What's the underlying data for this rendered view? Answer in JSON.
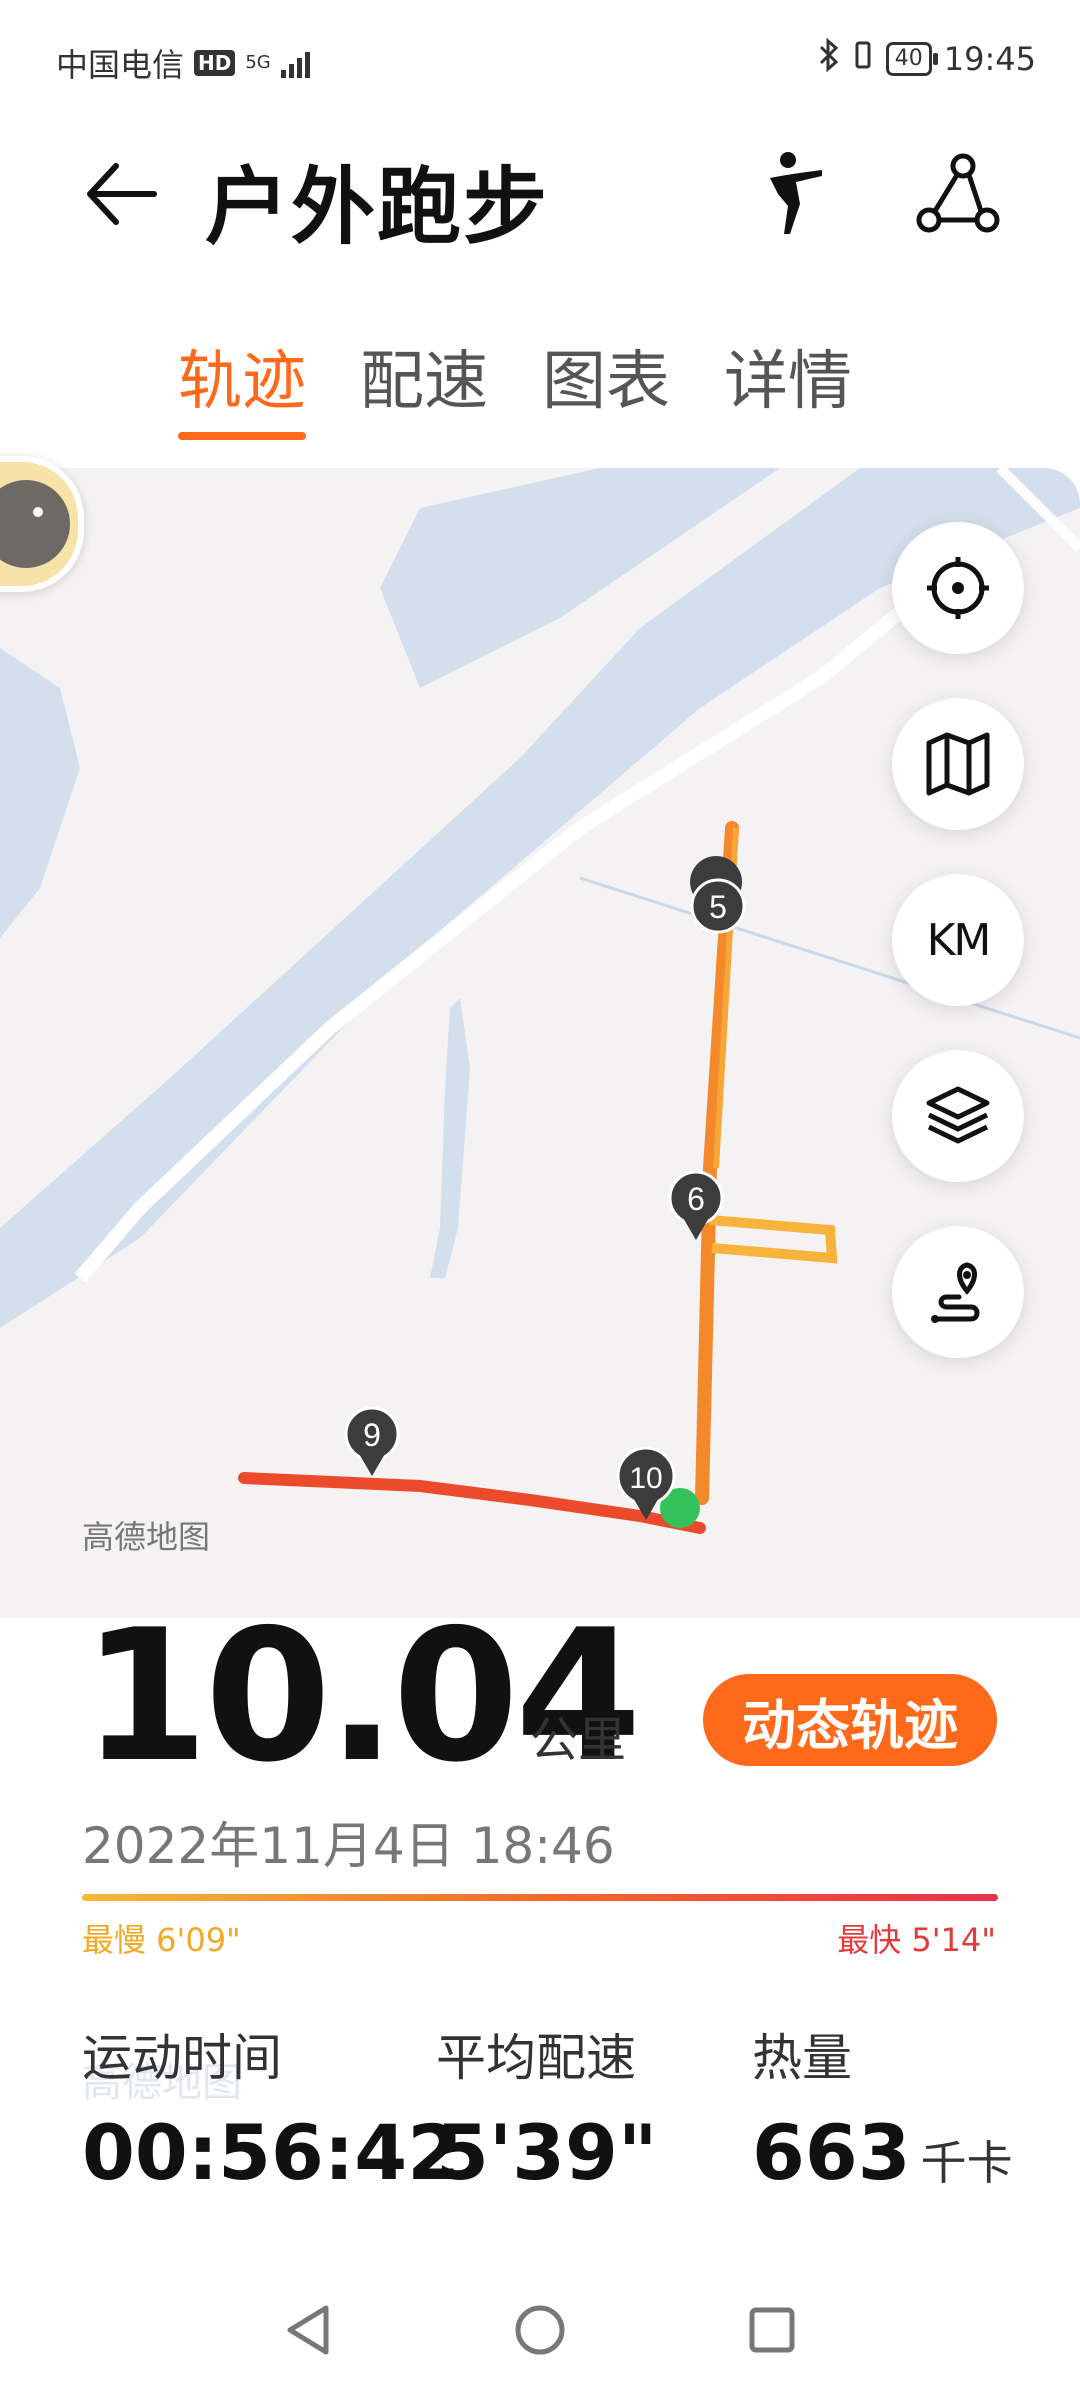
{
  "status_bar": {
    "carrier": "中国电信",
    "hd": "HD",
    "network": "5G",
    "battery": "40",
    "time": "19:45"
  },
  "header": {
    "title": "户外跑步"
  },
  "tabs": [
    {
      "label": "轨迹",
      "active": true
    },
    {
      "label": "配速",
      "active": false
    },
    {
      "label": "图表",
      "active": false
    },
    {
      "label": "详情",
      "active": false
    }
  ],
  "map": {
    "attribution": "高德地图",
    "controls": [
      {
        "name": "locate-icon"
      },
      {
        "name": "map-icon"
      },
      {
        "name": "km-toggle",
        "label": "KM"
      },
      {
        "name": "layers-icon"
      },
      {
        "name": "route-icon"
      }
    ],
    "markers": [
      "5",
      "6",
      "9",
      "10"
    ]
  },
  "summary": {
    "distance": "10.04",
    "distance_unit": "公里",
    "dynamic_track_button": "动态轨迹",
    "datetime": "2022年11月4日 18:46",
    "slowest": "最慢 6'09\"",
    "fastest": "最快 5'14\""
  },
  "stats": [
    {
      "label": "运动时间",
      "value": "00:56:42",
      "unit": ""
    },
    {
      "label": "平均配速",
      "value": "5'39\"",
      "unit": ""
    },
    {
      "label": "热量",
      "value": "663",
      "unit": "千卡"
    }
  ],
  "watermark": "高德地图",
  "colors": {
    "accent": "#ff6a1a",
    "water": "#d3dfec",
    "track_slow": "#f5a031",
    "track_fast": "#e8402e"
  }
}
